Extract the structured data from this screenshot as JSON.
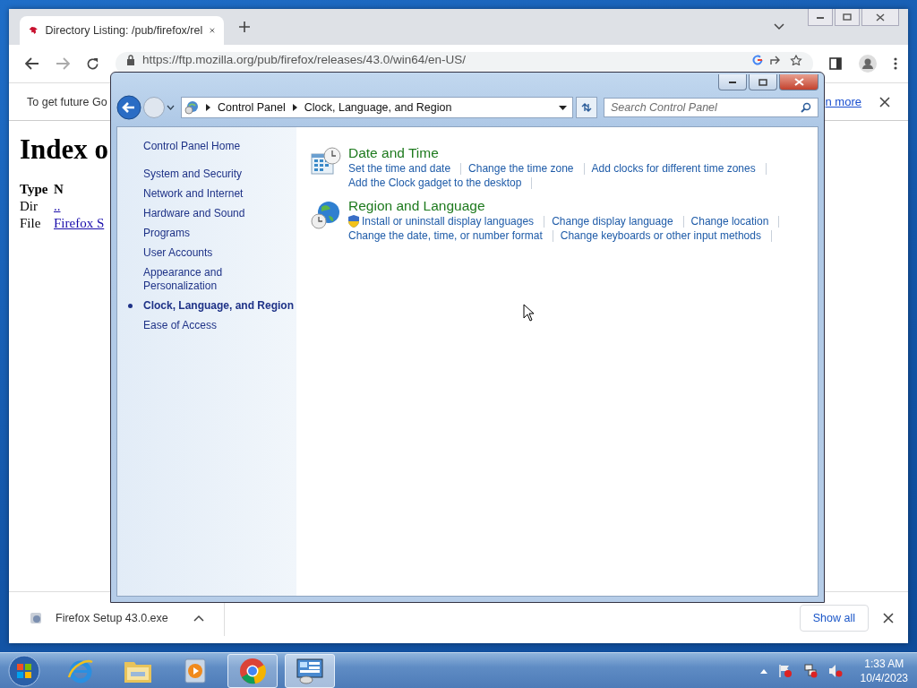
{
  "browser": {
    "tab": {
      "title": "Directory Listing: /pub/firefox/rel"
    },
    "address": "https://ftp.mozilla.org/pub/firefox/releases/43.0/win64/en-US/",
    "infobar": {
      "text": "To get future Go",
      "link": "n more"
    },
    "page": {
      "heading": "Index o",
      "columns": [
        "Type",
        "N"
      ],
      "rows": [
        {
          "type": "Dir",
          "name": ".."
        },
        {
          "type": "File",
          "name": "Firefox S"
        }
      ]
    },
    "downloads": {
      "file": "Firefox Setup 43.0.exe",
      "show_all": "Show all"
    }
  },
  "control_panel": {
    "breadcrumb": [
      "Control Panel",
      "Clock, Language, and Region"
    ],
    "search": {
      "placeholder": "Search Control Panel"
    },
    "sidebar": {
      "home": "Control Panel Home",
      "items": [
        {
          "label": "System and Security",
          "selected": false
        },
        {
          "label": "Network and Internet",
          "selected": false
        },
        {
          "label": "Hardware and Sound",
          "selected": false
        },
        {
          "label": "Programs",
          "selected": false
        },
        {
          "label": "User Accounts",
          "selected": false
        },
        {
          "label": "Appearance and Personalization",
          "selected": false
        },
        {
          "label": "Clock, Language, and Region",
          "selected": true
        },
        {
          "label": "Ease of Access",
          "selected": false
        }
      ]
    },
    "categories": [
      {
        "kind": "datetime",
        "title": "Date and Time",
        "links": [
          {
            "label": "Set the time and date",
            "shield": false
          },
          {
            "label": "Change the time zone",
            "shield": false
          },
          {
            "label": "Add clocks for different time zones",
            "shield": false
          },
          {
            "label": "Add the Clock gadget to the desktop",
            "shield": false
          }
        ]
      },
      {
        "kind": "region",
        "title": "Region and Language",
        "links": [
          {
            "label": "Install or uninstall display languages",
            "shield": true
          },
          {
            "label": "Change display language",
            "shield": false
          },
          {
            "label": "Change location",
            "shield": false
          },
          {
            "label": "Change the date, time, or number format",
            "shield": false
          },
          {
            "label": "Change keyboards or other input methods",
            "shield": false
          }
        ]
      }
    ]
  },
  "taskbar": {
    "apps": [
      {
        "kind": "ie",
        "open": false,
        "selected": false
      },
      {
        "kind": "explorer",
        "open": false,
        "selected": false
      },
      {
        "kind": "media",
        "open": false,
        "selected": false
      },
      {
        "kind": "chrome",
        "open": true,
        "selected": false
      },
      {
        "kind": "control",
        "open": true,
        "selected": true
      }
    ],
    "clock": {
      "time": "1:33 AM",
      "date": "10/4/2023"
    }
  }
}
